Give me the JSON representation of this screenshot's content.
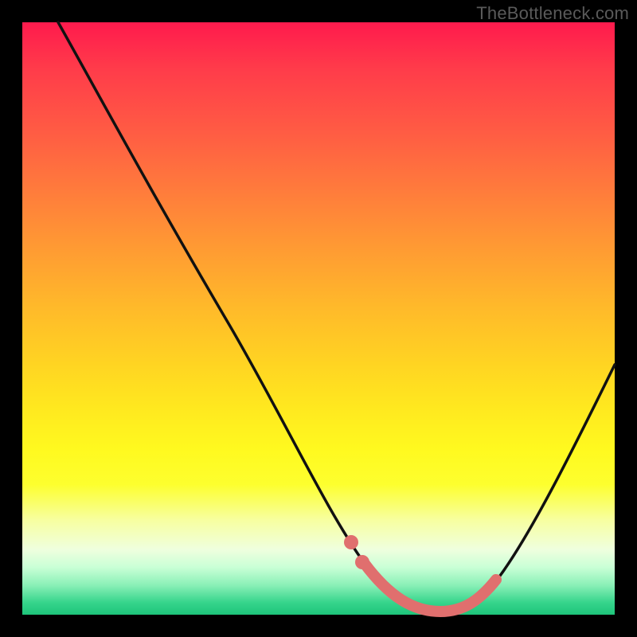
{
  "watermark": "TheBottleneck.com",
  "colors": {
    "curve_stroke": "#111111",
    "highlight_stroke": "#e06f6e",
    "gradient_top": "#ff1a4d",
    "gradient_bottom": "#1ec47a",
    "frame": "#000000"
  },
  "chart_data": {
    "type": "line",
    "title": "",
    "xlabel": "",
    "ylabel": "",
    "xlim": [
      0,
      100
    ],
    "ylim": [
      0,
      100
    ],
    "grid": false,
    "series": [
      {
        "name": "bottleneck-curve",
        "x": [
          6,
          10,
          20,
          30,
          40,
          50,
          52,
          55,
          58,
          62,
          66,
          70,
          73,
          76,
          80,
          85,
          90,
          95,
          100
        ],
        "y": [
          100,
          93,
          77,
          60,
          43,
          23,
          18,
          12,
          7,
          3,
          1,
          0,
          0,
          1,
          4,
          11,
          20,
          31,
          43
        ]
      },
      {
        "name": "optimal-range-highlight",
        "x": [
          55,
          58,
          62,
          66,
          70,
          73,
          76,
          78
        ],
        "y": [
          12,
          7,
          3,
          1,
          0,
          0,
          1,
          2
        ]
      }
    ],
    "annotations": [
      {
        "type": "point",
        "x": 55,
        "y": 12
      },
      {
        "type": "point",
        "x": 58,
        "y": 7
      }
    ]
  }
}
